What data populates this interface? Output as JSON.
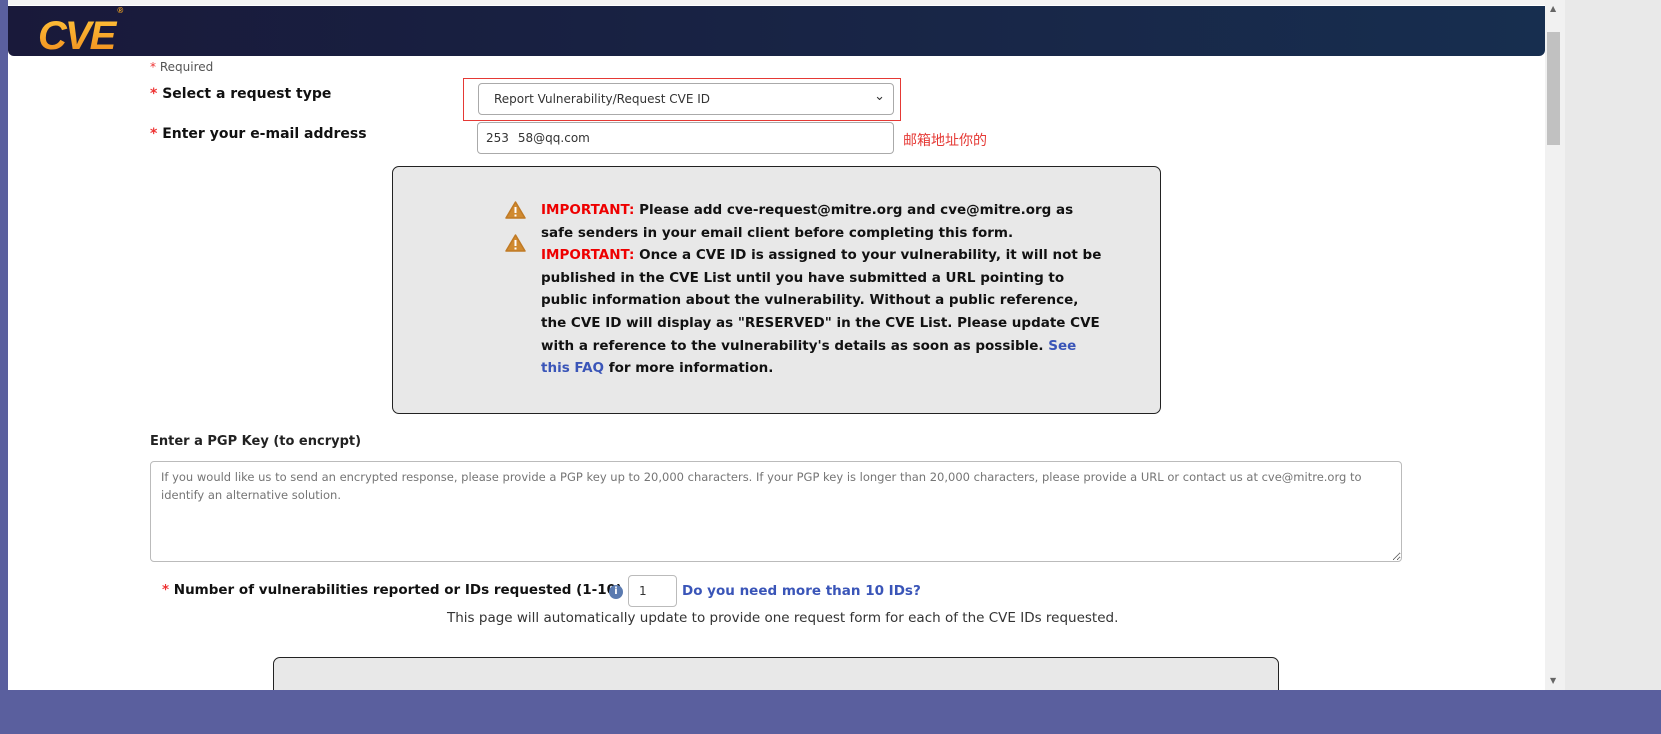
{
  "header": {
    "logo": "CVE",
    "logo_mark": "®"
  },
  "form": {
    "required_note": "Required",
    "asterisk": "*",
    "request_type_label": "Select a request type",
    "request_type_value": "Report Vulnerability/Request CVE ID",
    "email_label": "Enter your e-mail address",
    "email_value": "253   58@qq.com",
    "email_annotation": "邮箱地址你的",
    "important_prefix": "IMPORTANT:",
    "important_1": " Please add cve-request@mitre.org and cve@mitre.org as safe senders in your email client before completing this form.",
    "important_2": " Once a CVE ID is assigned to your vulnerability, it will not be published in the CVE List until you have submitted a URL pointing to public information about the vulnerability. Without a public reference, the CVE ID will display as \"RESERVED\" in the CVE List. Please update CVE with a reference to the vulnerability's details as soon as possible. ",
    "faq_link": "See this FAQ",
    "important_2_end": " for more information.",
    "pgp_label": "Enter a PGP Key (to encrypt)",
    "pgp_placeholder": "If you would like us to send an encrypted response, please provide a PGP key up to 20,000 characters. If your PGP key is longer than 20,000 characters, please provide a URL or contact us at cve@mitre.org to identify an alternative solution.",
    "num_label": "Number of vulnerabilities reported or IDs requested (1-10)",
    "num_value": "1",
    "more_ids_link": "Do you need more than 10 IDs?",
    "auto_update_note": "This page will automatically update to provide one request form for each of the CVE IDs requested."
  },
  "colors": {
    "header": "#19193a",
    "accent_red": "#e00000",
    "link": "#3a55b8",
    "warning": "#d08a30"
  }
}
